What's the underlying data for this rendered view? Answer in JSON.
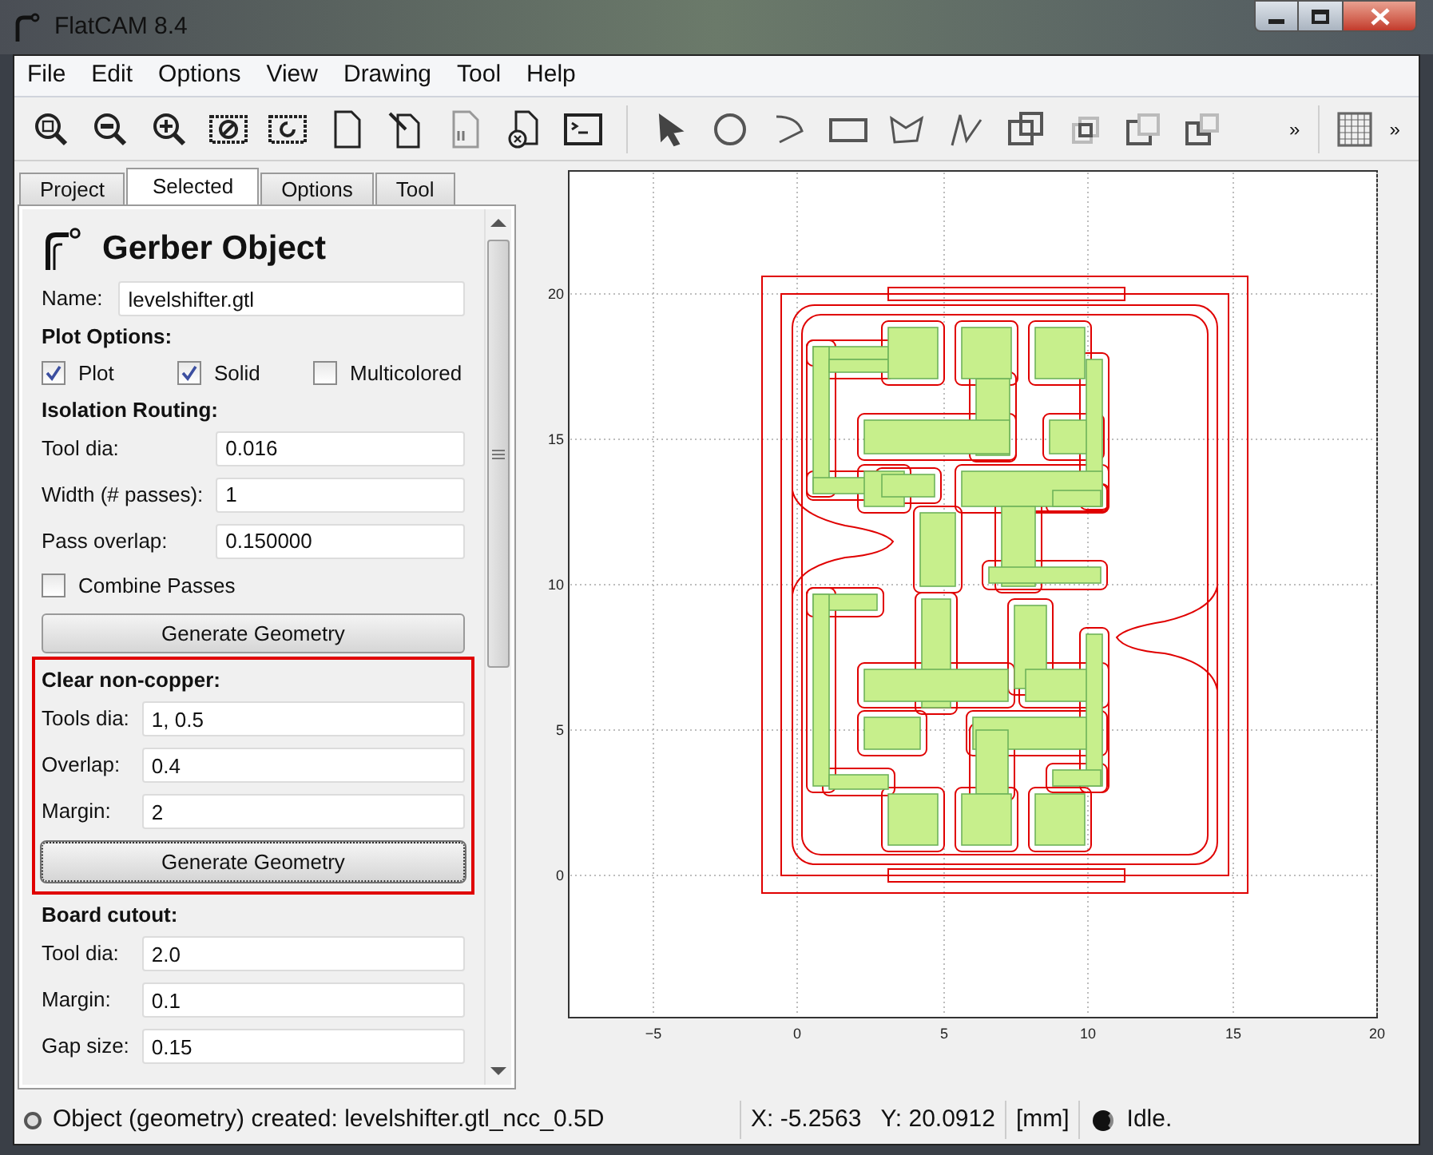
{
  "window": {
    "title": "FlatCAM 8.4"
  },
  "menu": [
    "File",
    "Edit",
    "Options",
    "View",
    "Drawing",
    "Tool",
    "Help"
  ],
  "toolbar": {
    "overflow": [
      "»",
      "»"
    ]
  },
  "tabs": [
    {
      "label": "Project",
      "selected": false
    },
    {
      "label": "Selected",
      "selected": true
    },
    {
      "label": "Options",
      "selected": false
    },
    {
      "label": "Tool",
      "selected": false
    }
  ],
  "panel": {
    "title": "Gerber Object",
    "name": {
      "label": "Name:",
      "value": "levelshifter.gtl"
    },
    "sections": [
      {
        "heading": "Plot Options:",
        "highlighted": false,
        "rows": [
          {
            "kind": "checks",
            "items": [
              {
                "label": "Plot",
                "checked": true
              },
              {
                "label": "Solid",
                "checked": true
              },
              {
                "label": "Multicolored",
                "checked": false
              }
            ]
          }
        ]
      },
      {
        "heading": "Isolation Routing:",
        "highlighted": false,
        "rows": [
          {
            "kind": "field",
            "label": "Tool dia:",
            "value": "0.016"
          },
          {
            "kind": "field",
            "label": "Width (# passes):",
            "value": "1"
          },
          {
            "kind": "field",
            "label": "Pass overlap:",
            "value": "0.150000"
          },
          {
            "kind": "checkbox",
            "label": "Combine Passes",
            "checked": false
          },
          {
            "kind": "button",
            "label": "Generate Geometry",
            "focused": false
          }
        ]
      },
      {
        "heading": "Clear non-copper:",
        "highlighted": true,
        "rows": [
          {
            "kind": "field",
            "label": "Tools dia:",
            "value": "1, 0.5"
          },
          {
            "kind": "field",
            "label": "Overlap:",
            "value": "0.4"
          },
          {
            "kind": "field",
            "label": "Margin:",
            "value": "2"
          },
          {
            "kind": "button",
            "label": "Generate Geometry",
            "focused": true
          }
        ]
      },
      {
        "heading": "Board cutout:",
        "highlighted": false,
        "rows": [
          {
            "kind": "field",
            "label": "Tool dia:",
            "value": "2.0"
          },
          {
            "kind": "field",
            "label": "Margin:",
            "value": "0.1"
          },
          {
            "kind": "field",
            "label": "Gap size:",
            "value": "0.15"
          }
        ]
      }
    ]
  },
  "plot": {
    "xticks": [
      "−5",
      "0",
      "5",
      "10",
      "15",
      "20"
    ],
    "yticks": [
      "20",
      "15",
      "10",
      "5",
      "0"
    ]
  },
  "status_bar": {
    "message": "Object (geometry) created: levelshifter.gtl_ncc_0.5D",
    "x": "X: -5.2563",
    "y": "Y: 20.0912",
    "units": "[mm]",
    "state": "Idle."
  }
}
